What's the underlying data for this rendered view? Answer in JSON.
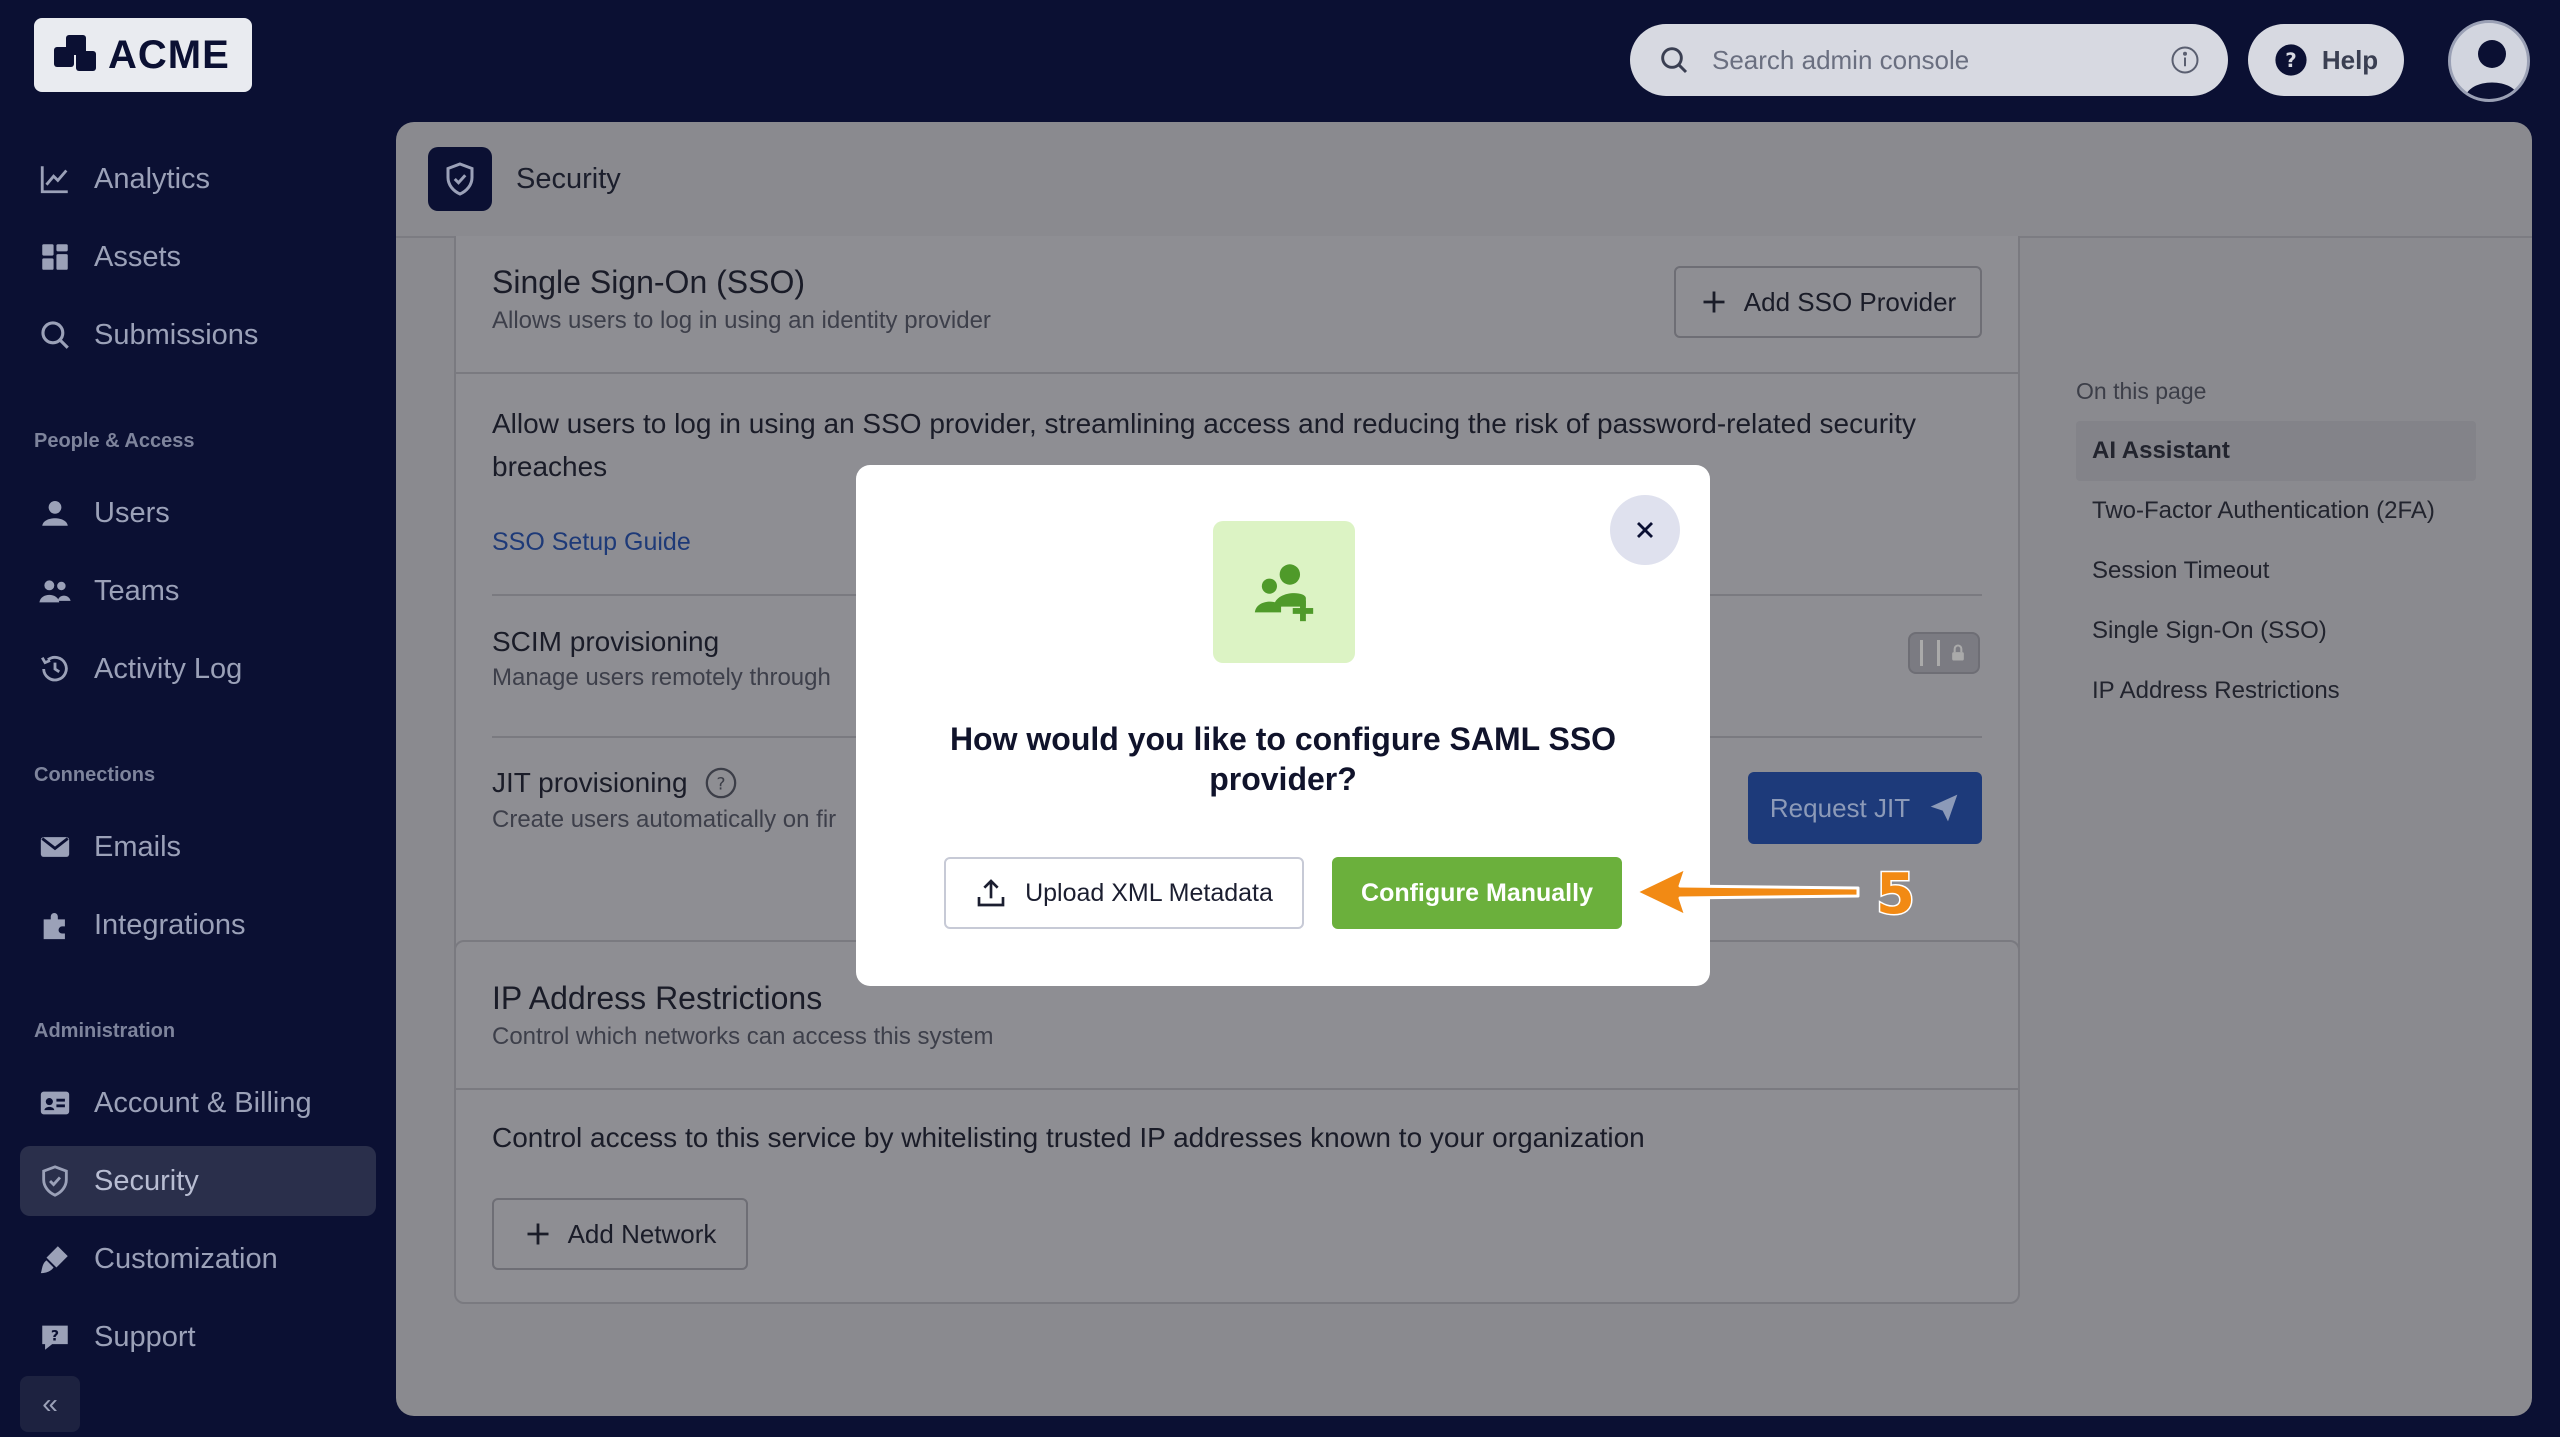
{
  "brand": {
    "name": "ACME"
  },
  "search": {
    "placeholder": "Search admin console"
  },
  "help": {
    "label": "Help"
  },
  "sidebar": {
    "items": [
      {
        "label": "Analytics",
        "icon": "chart-line-icon"
      },
      {
        "label": "Assets",
        "icon": "grid-icon"
      },
      {
        "label": "Submissions",
        "icon": "search-icon"
      }
    ],
    "sections": [
      {
        "title": "People & Access",
        "items": [
          {
            "label": "Users"
          },
          {
            "label": "Teams"
          },
          {
            "label": "Activity Log"
          }
        ]
      },
      {
        "title": "Connections",
        "items": [
          {
            "label": "Emails"
          },
          {
            "label": "Integrations"
          }
        ]
      },
      {
        "title": "Administration",
        "items": [
          {
            "label": "Account & Billing"
          },
          {
            "label": "Security"
          },
          {
            "label": "Customization"
          },
          {
            "label": "Support"
          }
        ]
      }
    ],
    "collapse_label": "«"
  },
  "page": {
    "title": "Security"
  },
  "sso": {
    "title": "Single Sign-On (SSO)",
    "subtitle": "Allows users to log in using an identity provider",
    "add_button": "Add SSO Provider",
    "description": "Allow users to log in using an SSO provider, streamlining access and reducing the risk of password-related security breaches",
    "guide_link": "SSO Setup Guide",
    "scim_title": "SCIM provisioning",
    "scim_sub": "Manage users remotely through",
    "jit_title": "JIT provisioning",
    "jit_sub": "Create users automatically on fir",
    "jit_button": "Request JIT"
  },
  "ip": {
    "title": "IP Address Restrictions",
    "subtitle": "Control which networks can access this system",
    "description": "Control access to this service by whitelisting trusted IP addresses known to your organization",
    "add_button": "Add Network"
  },
  "toc": {
    "heading": "On this page",
    "items": [
      {
        "label": "AI Assistant",
        "active": true
      },
      {
        "label": "Two-Factor Authentication (2FA)"
      },
      {
        "label": "Session Timeout"
      },
      {
        "label": "Single Sign-On (SSO)"
      },
      {
        "label": "IP Address Restrictions"
      }
    ]
  },
  "modal": {
    "title": "How would you like to configure SAML SSO provider?",
    "upload_button": "Upload XML Metadata",
    "manual_button": "Configure Manually",
    "icon": "user-add-icon"
  },
  "callout": {
    "step": "5",
    "color": "#f28a14"
  },
  "colors": {
    "accent_green": "#6bb03c",
    "nav_bg": "#0b1033",
    "jit_blue": "#1d3a7a"
  }
}
